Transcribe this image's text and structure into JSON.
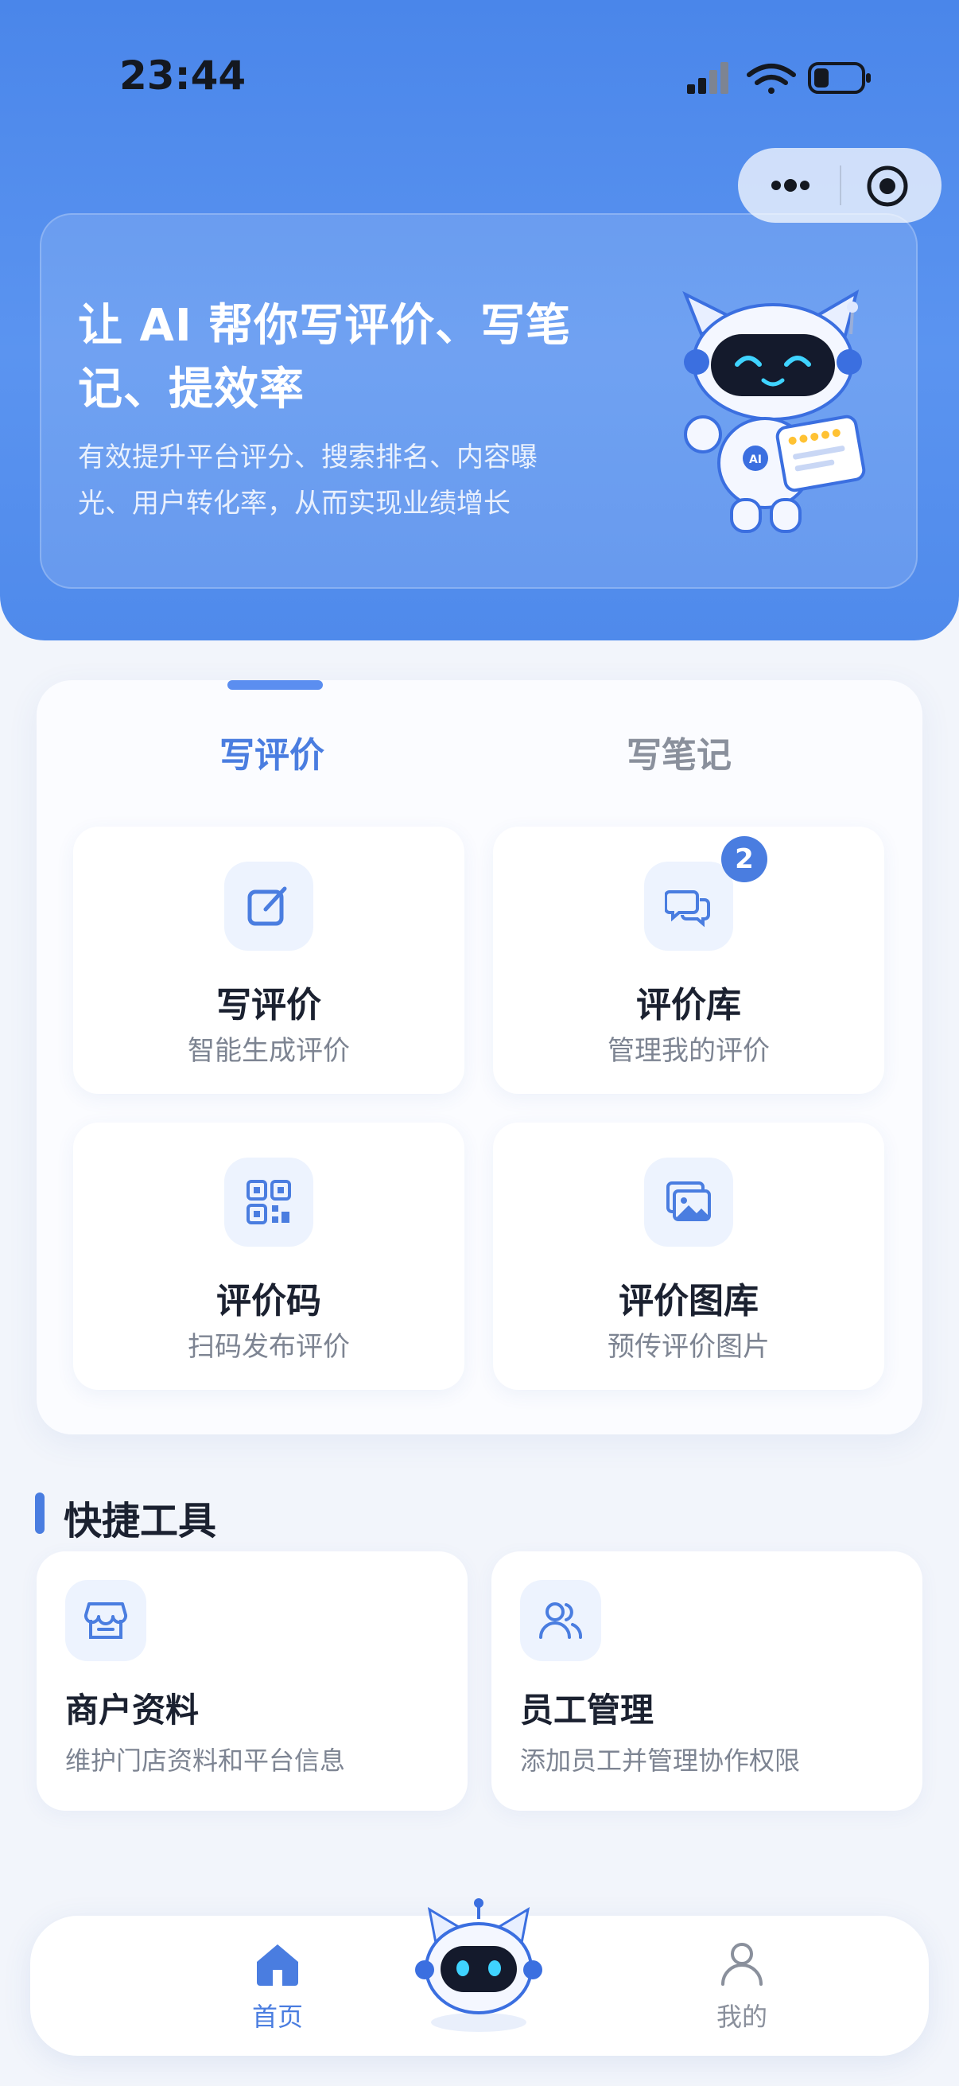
{
  "status_bar": {
    "time": "23:44"
  },
  "hero": {
    "title": "让 AI 帮你写评价、写笔记、提效率",
    "subtitle": "有效提升平台评分、搜索排名、内容曝光、用户转化率，从而实现业绩增长"
  },
  "tabs": [
    {
      "label": "写评价",
      "active": true
    },
    {
      "label": "写笔记",
      "active": false
    }
  ],
  "tiles": [
    {
      "title": "写评价",
      "subtitle": "智能生成评价",
      "icon": "edit-icon"
    },
    {
      "title": "评价库",
      "subtitle": "管理我的评价",
      "icon": "chat-bubbles-icon",
      "badge": "2"
    },
    {
      "title": "评价码",
      "subtitle": "扫码发布评价",
      "icon": "qr-code-icon"
    },
    {
      "title": "评价图库",
      "subtitle": "预传评价图片",
      "icon": "image-gallery-icon"
    }
  ],
  "quick_tools": {
    "title": "快捷工具",
    "items": [
      {
        "title": "商户资料",
        "subtitle": "维护门店资料和平台信息",
        "icon": "store-icon"
      },
      {
        "title": "员工管理",
        "subtitle": "添加员工并管理协作权限",
        "icon": "users-icon"
      }
    ]
  },
  "tabbar": {
    "home": "首页",
    "me": "我的"
  },
  "colors": {
    "primary": "#4a7de0",
    "hero_bg": "#5b94f0",
    "page_bg": "#f2f5fb"
  }
}
